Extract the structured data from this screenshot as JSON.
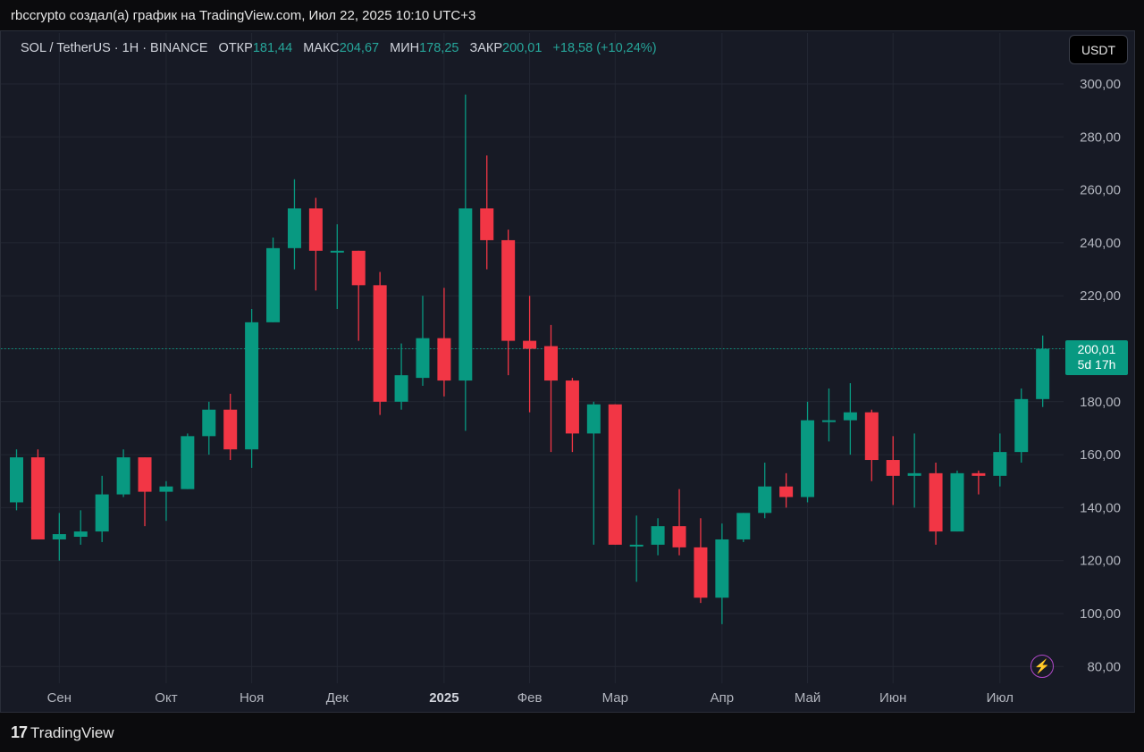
{
  "attribution": "rbccrypto создал(а) график на TradingView.com, Июл 22, 2025 10:10 UTC+3",
  "legend": {
    "symbol": "SOL / TetherUS · 1Н · BINANCE",
    "open_label": "ОТКР",
    "open_value": "181,44",
    "high_label": "МАКС",
    "high_value": "204,67",
    "low_label": "МИН",
    "low_value": "178,25",
    "close_label": "ЗАКР",
    "close_value": "200,01",
    "change": "+18,58 (+10,24%)"
  },
  "currency_button": "USDT",
  "price_label": {
    "price": "200,01",
    "countdown": "5d 17h"
  },
  "flash_icon": "lightning-icon",
  "logo": {
    "mark": "17",
    "text": "TradingView"
  },
  "colors": {
    "up": "#089981",
    "down": "#f23645",
    "background": "#171a25",
    "grid": "#232733"
  },
  "chart_data": {
    "type": "candlestick",
    "y_ticks": [
      "80,00",
      "100,00",
      "120,00",
      "140,00",
      "160,00",
      "180,00",
      "200,00",
      "220,00",
      "240,00",
      "260,00",
      "280,00",
      "300,00"
    ],
    "y_range": [
      80,
      300
    ],
    "last_price": 200.01,
    "x_labels": [
      {
        "label": "Сен",
        "index": 2
      },
      {
        "label": "Окт",
        "index": 7
      },
      {
        "label": "Ноя",
        "index": 11
      },
      {
        "label": "Дек",
        "index": 15
      },
      {
        "label": "2025",
        "index": 20,
        "bold": true
      },
      {
        "label": "Фев",
        "index": 24
      },
      {
        "label": "Мар",
        "index": 28
      },
      {
        "label": "Апр",
        "index": 33
      },
      {
        "label": "Май",
        "index": 37
      },
      {
        "label": "Июн",
        "index": 41
      },
      {
        "label": "Июл",
        "index": 46
      }
    ],
    "candles": [
      {
        "o": 142,
        "h": 162,
        "l": 139,
        "c": 159
      },
      {
        "o": 159,
        "h": 162,
        "l": 128,
        "c": 128
      },
      {
        "o": 128,
        "h": 138,
        "l": 120,
        "c": 130
      },
      {
        "o": 129,
        "h": 139,
        "l": 126,
        "c": 131
      },
      {
        "o": 131,
        "h": 152,
        "l": 127,
        "c": 145
      },
      {
        "o": 145,
        "h": 162,
        "l": 144,
        "c": 159
      },
      {
        "o": 159,
        "h": 159,
        "l": 133,
        "c": 146
      },
      {
        "o": 146,
        "h": 150,
        "l": 135,
        "c": 148
      },
      {
        "o": 147,
        "h": 168,
        "l": 147,
        "c": 167
      },
      {
        "o": 167,
        "h": 180,
        "l": 160,
        "c": 177
      },
      {
        "o": 177,
        "h": 183,
        "l": 158,
        "c": 162
      },
      {
        "o": 162,
        "h": 215,
        "l": 155,
        "c": 210
      },
      {
        "o": 210,
        "h": 242,
        "l": 210,
        "c": 238
      },
      {
        "o": 238,
        "h": 264,
        "l": 230,
        "c": 253
      },
      {
        "o": 253,
        "h": 257,
        "l": 222,
        "c": 237
      },
      {
        "o": 237,
        "h": 247,
        "l": 215,
        "c": 237
      },
      {
        "o": 237,
        "h": 237,
        "l": 203,
        "c": 224
      },
      {
        "o": 224,
        "h": 229,
        "l": 175,
        "c": 180
      },
      {
        "o": 180,
        "h": 202,
        "l": 177,
        "c": 190
      },
      {
        "o": 189,
        "h": 220,
        "l": 186,
        "c": 204
      },
      {
        "o": 204,
        "h": 223,
        "l": 182,
        "c": 188
      },
      {
        "o": 188,
        "h": 296,
        "l": 169,
        "c": 253
      },
      {
        "o": 253,
        "h": 273,
        "l": 230,
        "c": 241
      },
      {
        "o": 241,
        "h": 245,
        "l": 190,
        "c": 203
      },
      {
        "o": 203,
        "h": 220,
        "l": 176,
        "c": 200
      },
      {
        "o": 201,
        "h": 209,
        "l": 161,
        "c": 188
      },
      {
        "o": 188,
        "h": 189,
        "l": 161,
        "c": 168
      },
      {
        "o": 168,
        "h": 180,
        "l": 126,
        "c": 179
      },
      {
        "o": 179,
        "h": 179,
        "l": 126,
        "c": 126
      },
      {
        "o": 126,
        "h": 137,
        "l": 112,
        "c": 126
      },
      {
        "o": 126,
        "h": 136,
        "l": 122,
        "c": 133
      },
      {
        "o": 133,
        "h": 147,
        "l": 122,
        "c": 125
      },
      {
        "o": 125,
        "h": 136,
        "l": 104,
        "c": 106
      },
      {
        "o": 106,
        "h": 134,
        "l": 96,
        "c": 128
      },
      {
        "o": 128,
        "h": 138,
        "l": 127,
        "c": 138
      },
      {
        "o": 138,
        "h": 157,
        "l": 136,
        "c": 148
      },
      {
        "o": 148,
        "h": 153,
        "l": 140,
        "c": 144
      },
      {
        "o": 144,
        "h": 180,
        "l": 142,
        "c": 173
      },
      {
        "o": 173,
        "h": 185,
        "l": 165,
        "c": 173
      },
      {
        "o": 173,
        "h": 187,
        "l": 160,
        "c": 176
      },
      {
        "o": 176,
        "h": 177,
        "l": 150,
        "c": 158
      },
      {
        "o": 158,
        "h": 167,
        "l": 141,
        "c": 152
      },
      {
        "o": 152,
        "h": 168,
        "l": 140,
        "c": 153
      },
      {
        "o": 153,
        "h": 157,
        "l": 126,
        "c": 131
      },
      {
        "o": 131,
        "h": 154,
        "l": 131,
        "c": 153
      },
      {
        "o": 153,
        "h": 154,
        "l": 145,
        "c": 152
      },
      {
        "o": 152,
        "h": 168,
        "l": 148,
        "c": 161
      },
      {
        "o": 161,
        "h": 185,
        "l": 157,
        "c": 181
      },
      {
        "o": 181,
        "h": 205,
        "l": 178,
        "c": 200
      }
    ]
  }
}
